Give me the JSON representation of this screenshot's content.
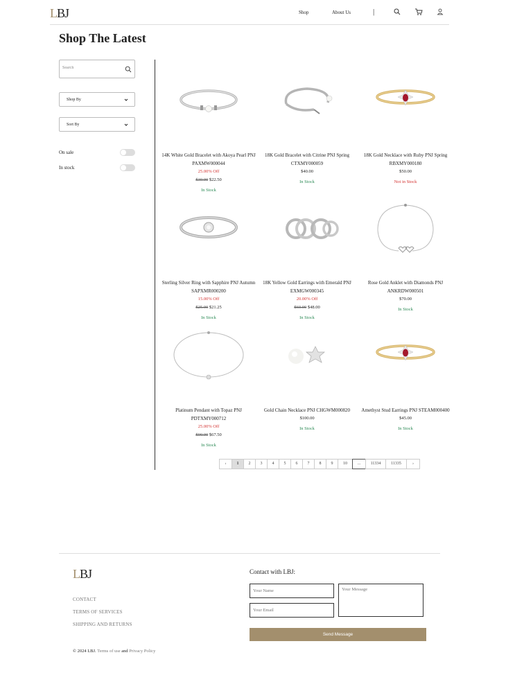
{
  "header": {
    "logo_first": "L",
    "logo_rest": "BJ",
    "nav_shop": "Shop",
    "nav_about": "About Us",
    "separator": "|"
  },
  "page_title": "Shop The Latest",
  "sidebar": {
    "search_placeholder": "Search",
    "shop_by": "Shop By",
    "sort_by": "Sort By",
    "on_sale": "On sale",
    "in_stock": "In stock"
  },
  "products": [
    {
      "name": "14K White Gold Bracelet with Akoya Pearl PNJ PAXMW000044",
      "off": "25.00% Off",
      "orig": "$30.00",
      "price": "$22.50",
      "stock": "In Stock"
    },
    {
      "name": "18K Gold Bracelet with Citrine PNJ Spring CTXMY000059",
      "off": "",
      "orig": "",
      "price": "$40.00",
      "stock": "In Stock"
    },
    {
      "name": "18K Gold Necklace with Ruby PNJ Spring RBXMY000180",
      "off": "",
      "orig": "",
      "price": "$50.00",
      "stock": "Not in Stock"
    },
    {
      "name": "Sterling Silver Ring with Sapphire PNJ Autumn SAPXMR000200",
      "off": "15.00% Off",
      "orig": "$25.00",
      "price": "$21.25",
      "stock": "In Stock"
    },
    {
      "name": "18K Yellow Gold Earrings with Emerald PNJ EXMGW000345",
      "off": "20.00% Off",
      "orig": "$60.00",
      "price": "$48.00",
      "stock": "In Stock"
    },
    {
      "name": "Rose Gold Anklet with Diamonds PNJ ANKRDW000501",
      "off": "",
      "orig": "",
      "price": "$70.00",
      "stock": "In Stock"
    },
    {
      "name": "Platinum Pendant with Topaz PNJ PDTXMY000712",
      "off": "25.00% Off",
      "orig": "$90.00",
      "price": "$67.50",
      "stock": "In Stock"
    },
    {
      "name": "Gold Chain Necklace PNJ CHGWM000820",
      "off": "",
      "orig": "",
      "price": "$100.00",
      "stock": "In Stock"
    },
    {
      "name": "Amethyst Stud Earrings PNJ STEAM000400",
      "off": "",
      "orig": "",
      "price": "$45.00",
      "stock": "In Stock"
    }
  ],
  "pagination": {
    "prev": "‹",
    "pages": [
      "1",
      "2",
      "3",
      "4",
      "5",
      "6",
      "7",
      "8",
      "9",
      "10",
      "...",
      "11334",
      "11335"
    ],
    "next": "›",
    "active": "1"
  },
  "footer": {
    "logo_first": "L",
    "logo_rest": "BJ",
    "links": [
      "CONTACT",
      "TERMS OF SERVICES",
      "SHIPPING AND RETURNS"
    ],
    "contact_title": "Contact with LBJ:",
    "name_placeholder": "Your Name",
    "email_placeholder": "Your Email",
    "message_placeholder": "Your Message",
    "send_label": "Send Message",
    "copyright_prefix": "© 2024 LBJ.",
    "terms_link": "Terms of use",
    "and_text": "and",
    "privacy_link": "Privacy Policy"
  },
  "colors": {
    "accent": "#a38f6d",
    "sale_red": "#d3302f",
    "stock_green": "#2e8b57"
  }
}
